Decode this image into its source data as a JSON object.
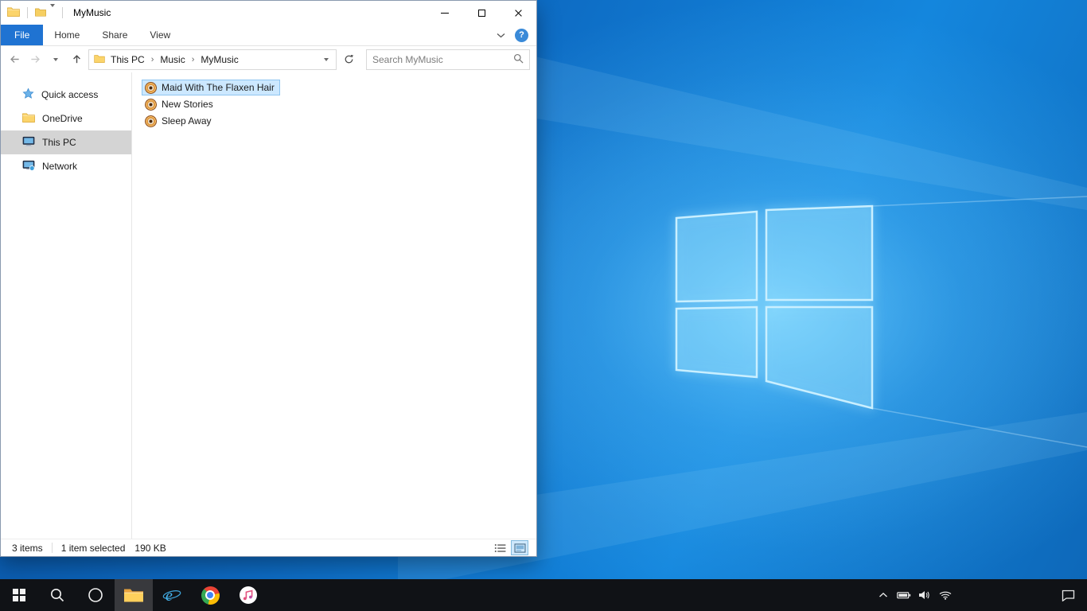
{
  "colors": {
    "accent_blue": "#0078d7",
    "selection_fill": "#cce8ff",
    "selection_border": "#99d1ff",
    "file_tab_blue": "#1f73d2",
    "sidebar_selected_gray": "#d4d4d4",
    "taskbar_black": "#101216",
    "wallpaper_blue": "#0d6ac2"
  },
  "explorer": {
    "title": "MyMusic",
    "ribbon": {
      "tabs": [
        {
          "label": "File"
        },
        {
          "label": "Home"
        },
        {
          "label": "Share"
        },
        {
          "label": "View"
        }
      ],
      "help": "?"
    },
    "address": {
      "breadcrumb": [
        "This PC",
        "Music",
        "MyMusic"
      ],
      "separator": "›"
    },
    "search": {
      "placeholder": "Search MyMusic"
    },
    "sidebar": [
      {
        "label": "Quick access",
        "icon": "star-icon"
      },
      {
        "label": "OneDrive",
        "icon": "onedrive-folder-icon"
      },
      {
        "label": "This PC",
        "icon": "computer-icon",
        "selected": true
      },
      {
        "label": "Network",
        "icon": "network-icon"
      }
    ],
    "files": [
      {
        "name": "Maid With The Flaxen Hair",
        "icon": "media-file-icon",
        "selected": true
      },
      {
        "name": "New Stories",
        "icon": "media-file-icon"
      },
      {
        "name": "Sleep Away",
        "icon": "media-file-icon"
      }
    ],
    "status": {
      "count": "3 items",
      "selected": "1 item selected",
      "size": "190 KB"
    }
  },
  "taskbar": {
    "buttons": [
      {
        "name": "start"
      },
      {
        "name": "search"
      },
      {
        "name": "cortana"
      },
      {
        "name": "file-explorer",
        "active": true
      },
      {
        "name": "internet-explorer"
      },
      {
        "name": "chrome"
      },
      {
        "name": "itunes"
      }
    ],
    "tray": [
      "tray-expand",
      "battery",
      "volume",
      "wifi"
    ],
    "action_center": "action-center"
  }
}
